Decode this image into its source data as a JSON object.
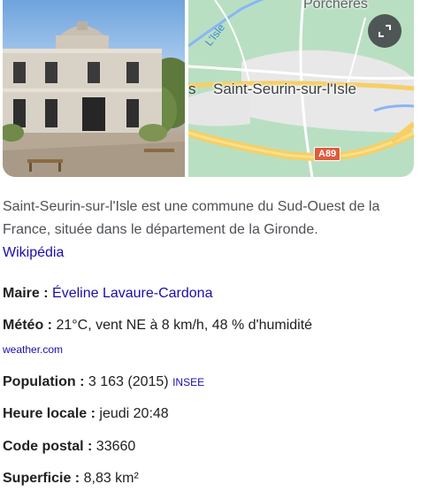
{
  "images": {
    "map_labels": {
      "top_place": "Porchères",
      "town": "Saint-Seurin-sur-l'Isle",
      "left_fragment": "s",
      "river": "L'Isle",
      "road": "A89"
    },
    "expand_icon": "expand-icon"
  },
  "description": {
    "text": "Saint-Seurin-sur-l'Isle est une commune du Sud-Ouest de la France, située dans le département de la Gironde.",
    "source_link": "Wikipédia"
  },
  "facts": {
    "maire": {
      "label": "Maire :",
      "value": "Éveline Lavaure-Cardona"
    },
    "meteo": {
      "label": "Météo :",
      "value": "21°C, vent NE à 8 km/h, 48 % d'humidité",
      "source": "weather.com"
    },
    "population": {
      "label": "Population :",
      "value": "3 163 (2015)",
      "source": "INSEE"
    },
    "heure_locale": {
      "label": "Heure locale :",
      "value": "jeudi 20:48"
    },
    "code_postal": {
      "label": "Code postal :",
      "value": "33660"
    },
    "superficie": {
      "label": "Superficie :",
      "value": "8,83 km²"
    }
  },
  "colors": {
    "link": "#1a0dab",
    "text": "#202124",
    "muted_text": "#4d5156",
    "map_green": "#b9dfc2",
    "road_yellow": "#f6cf65"
  }
}
